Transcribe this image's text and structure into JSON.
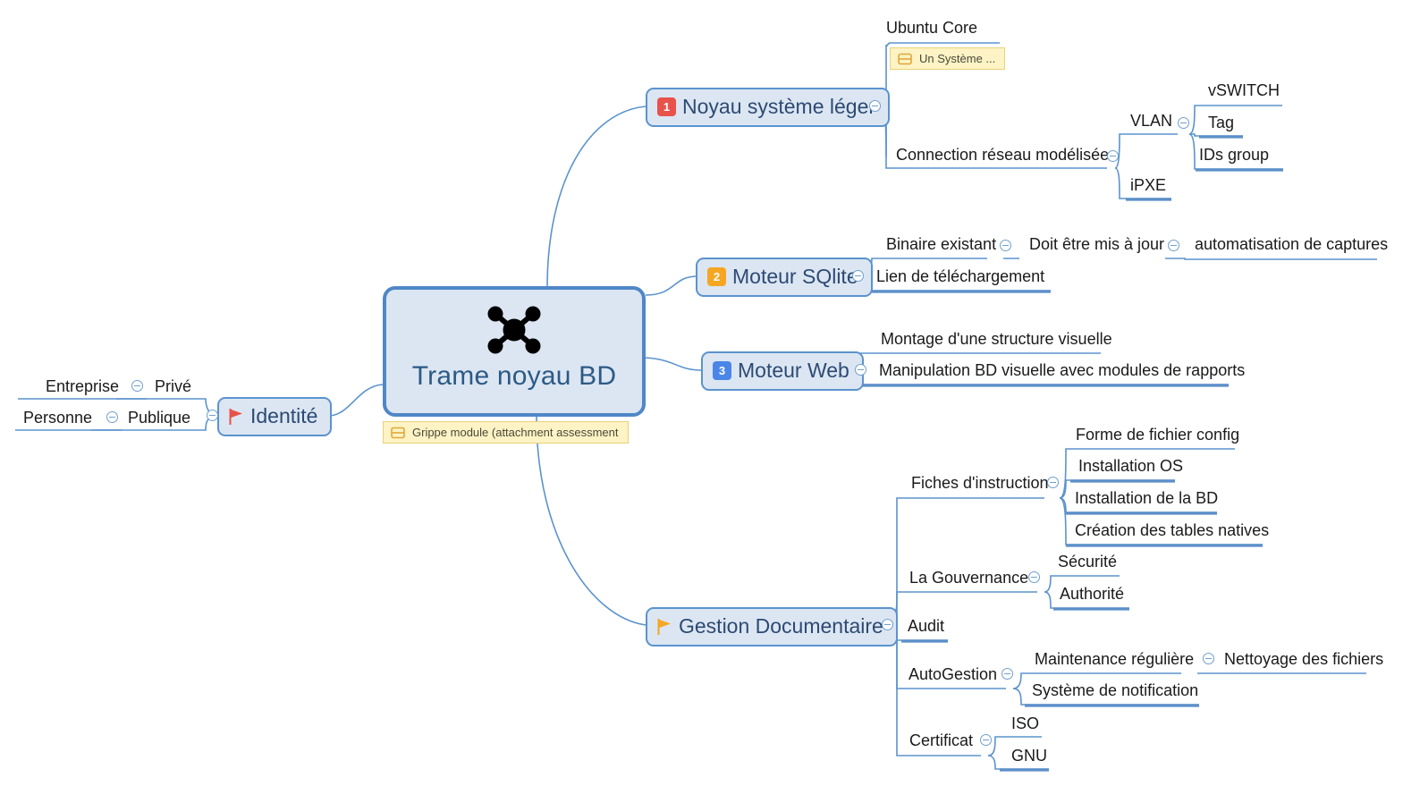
{
  "root": {
    "label": "Trame noyau BD",
    "icon": "network-hub-icon",
    "note": "Grippe module (attachment assessment",
    "fill": "#dce6f2",
    "border": "#4f87c7",
    "text_color": "#2c5a86"
  },
  "colors": {
    "line": "#5b93cd",
    "leaf_underline": "#5b8fc9",
    "branch_underline": "#7ba7d6",
    "badge_red": "#e8524a",
    "badge_orange": "#f5a623",
    "badge_blue": "#4a86e8",
    "note_bg": "#fdf3c4",
    "note_border": "#e8d27a",
    "flag_red": "#e8524a",
    "flag_orange": "#f5a623"
  },
  "branches": [
    {
      "id": "noyau",
      "label": "Noyau système léger",
      "badge": "1",
      "badge_color": "#e8524a",
      "children": [
        {
          "label": "Ubuntu Core",
          "note": "Un Système ...",
          "children": []
        },
        {
          "label": "Connection réseau modélisée",
          "children": [
            {
              "label": "VLAN",
              "children": [
                {
                  "label": "vSWITCH"
                },
                {
                  "label": "Tag"
                },
                {
                  "label": "IDs group"
                }
              ]
            },
            {
              "label": "iPXE"
            }
          ]
        }
      ]
    },
    {
      "id": "sqlite",
      "label": "Moteur SQlite",
      "badge": "2",
      "badge_color": "#f5a623",
      "children": [
        {
          "label": "Binaire existant",
          "children": [
            {
              "label": "Doit être mis à jour",
              "children": [
                {
                  "label": "automatisation de captures"
                }
              ]
            }
          ]
        },
        {
          "label": "Lien de téléchargement"
        }
      ]
    },
    {
      "id": "web",
      "label": "Moteur Web",
      "badge": "3",
      "badge_color": "#4a86e8",
      "children": [
        {
          "label": "Montage d'une structure visuelle"
        },
        {
          "label": "Manipulation BD visuelle avec modules de rapports"
        }
      ]
    },
    {
      "id": "gestion",
      "label": "Gestion Documentaire",
      "flag": "orange-flag-icon",
      "children": [
        {
          "label": "Fiches d'instruction",
          "children": [
            {
              "label": "Forme de fichier config"
            },
            {
              "label": "Installation OS"
            },
            {
              "label": "Installation de la BD"
            },
            {
              "label": "Création des tables natives"
            }
          ]
        },
        {
          "label": "La Gouvernance",
          "children": [
            {
              "label": "Sécurité"
            },
            {
              "label": "Authorité"
            }
          ]
        },
        {
          "label": "Audit"
        },
        {
          "label": "AutoGestion",
          "children": [
            {
              "label": "Maintenance régulière",
              "children": [
                {
                  "label": "Nettoyage des fichiers"
                }
              ]
            },
            {
              "label": "Système de notification"
            }
          ]
        },
        {
          "label": "Certificat",
          "children": [
            {
              "label": "ISO"
            },
            {
              "label": "GNU"
            }
          ]
        }
      ]
    },
    {
      "id": "identite",
      "label": "Identité",
      "flag": "red-flag-icon",
      "side": "left",
      "children": [
        {
          "label": "Entreprise",
          "children": [
            {
              "label": "Privé"
            }
          ]
        },
        {
          "label": "Personne",
          "children": [
            {
              "label": "Publique"
            }
          ]
        }
      ]
    }
  ],
  "topics": {
    "ubuntu_core": "Ubuntu Core",
    "ubuntu_note": "Un Système ...",
    "connection": "Connection réseau modélisée",
    "vlan": "VLAN",
    "vswitch": "vSWITCH",
    "tag": "Tag",
    "ids_group": "IDs group",
    "ipxe": "iPXE",
    "binaire": "Binaire existant",
    "doit_etre": "Doit être mis à jour",
    "automatisation": "automatisation de captures",
    "lien": "Lien de téléchargement",
    "montage": "Montage d'une structure visuelle",
    "manipulation": "Manipulation BD visuelle avec modules de rapports",
    "fiches": "Fiches d'instruction",
    "forme": "Forme de fichier config",
    "install_os": "Installation OS",
    "install_bd": "Installation de la BD",
    "creation": "Création des tables natives",
    "gouvernance": "La Gouvernance",
    "securite": "Sécurité",
    "authorite": "Authorité",
    "audit": "Audit",
    "autogestion": "AutoGestion",
    "maintenance": "Maintenance régulière",
    "nettoyage": "Nettoyage des fichiers",
    "notification": "Système de notification",
    "certificat": "Certificat",
    "iso": "ISO",
    "gnu": "GNU",
    "entreprise": "Entreprise",
    "prive": "Privé",
    "personne": "Personne",
    "publique": "Publique"
  }
}
